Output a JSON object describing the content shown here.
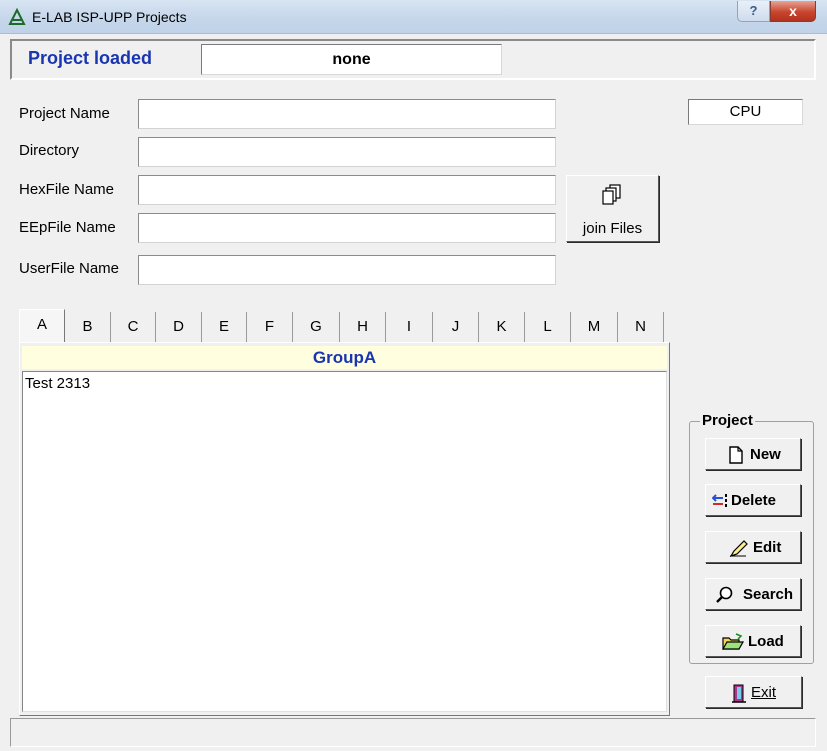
{
  "window": {
    "title": "E-LAB ISP-UPP Projects",
    "help_label": "?",
    "close_label": "x"
  },
  "loaded": {
    "label": "Project loaded",
    "value": "none"
  },
  "fields": [
    {
      "label": "Project Name",
      "value": ""
    },
    {
      "label": "Directory",
      "value": ""
    },
    {
      "label": "HexFile Name",
      "value": ""
    },
    {
      "label": "EEpFile Name",
      "value": ""
    },
    {
      "label": "UserFile Name",
      "value": ""
    }
  ],
  "cpu": "CPU",
  "join_button": {
    "label": "join Files",
    "icon": "copy-icon"
  },
  "tabs": [
    "A",
    "B",
    "C",
    "D",
    "E",
    "F",
    "G",
    "H",
    "I",
    "J",
    "K",
    "L",
    "M",
    "N"
  ],
  "active_tab": "A",
  "group": {
    "title": "GroupA",
    "items": [
      "Test 2313"
    ]
  },
  "project_box": {
    "title": "Project",
    "buttons": [
      {
        "label": "New",
        "icon": "new-file-icon"
      },
      {
        "label": "Delete",
        "icon": "delete-icon"
      },
      {
        "label": "Edit",
        "icon": "pen-icon"
      },
      {
        "label": "Search",
        "icon": "magnifier-icon"
      },
      {
        "label": "Load",
        "icon": "open-folder-icon"
      }
    ]
  },
  "exit_button": {
    "label": "Exit",
    "icon": "exit-door-icon"
  },
  "colors": {
    "accent_text": "#1a35b0",
    "group_header_bg": "#ffffe0"
  }
}
